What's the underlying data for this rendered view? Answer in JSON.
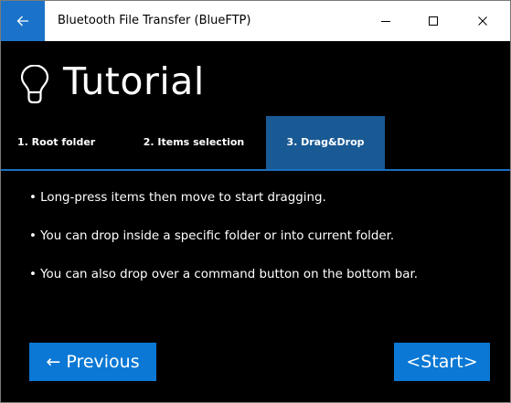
{
  "window": {
    "title": "Bluetooth File Transfer (BlueFTP)"
  },
  "header": {
    "title": "Tutorial",
    "icon": "lightbulb-icon"
  },
  "tabs": [
    {
      "label": "1. Root folder",
      "selected": false
    },
    {
      "label": "2. Items selection",
      "selected": false
    },
    {
      "label": "3. Drag&Drop",
      "selected": true
    }
  ],
  "content": {
    "lines": [
      "• Long-press items then move to start dragging.",
      "• You can drop inside a specific folder or into current folder.",
      "• You can also drop over a command button on the bottom bar."
    ]
  },
  "buttons": {
    "previous": "← Previous",
    "start": "<Start>"
  },
  "colors": {
    "accent": "#0a78d4",
    "selected_tab": "#1a5a94",
    "background": "#000000"
  }
}
